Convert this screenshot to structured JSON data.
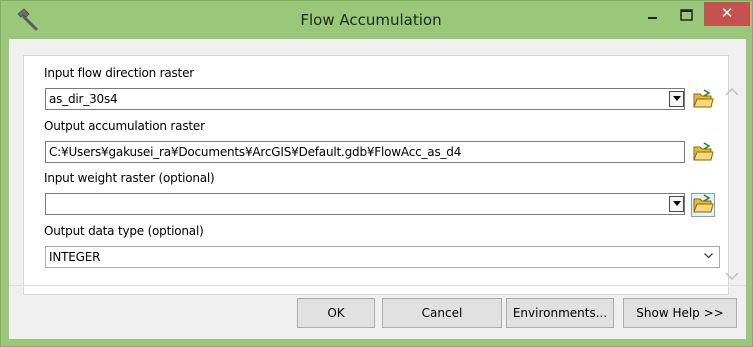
{
  "window": {
    "title": "Flow Accumulation",
    "close_glyph": "✕"
  },
  "params": {
    "flow_dir": {
      "label": "Input flow direction raster",
      "value": "as_dir_30s4"
    },
    "output_acc": {
      "label": "Output accumulation raster",
      "value": "C:¥Users¥gakusei_ra¥Documents¥ArcGIS¥Default.gdb¥FlowAcc_as_d4"
    },
    "weight": {
      "label": "Input weight raster (optional)",
      "value": ""
    },
    "data_type": {
      "label": "Output data type (optional)",
      "value": "INTEGER"
    }
  },
  "buttons": {
    "ok": "OK",
    "cancel": "Cancel",
    "environments": "Environments...",
    "show_help": "Show Help >>"
  },
  "colors": {
    "titlebar": "#9bc77a",
    "close": "#c75050",
    "folder": "#e8b830"
  },
  "icons": {
    "app": "hammer-icon",
    "browse": "open-folder-icon",
    "dropdown": "dropdown-arrow-icon"
  }
}
